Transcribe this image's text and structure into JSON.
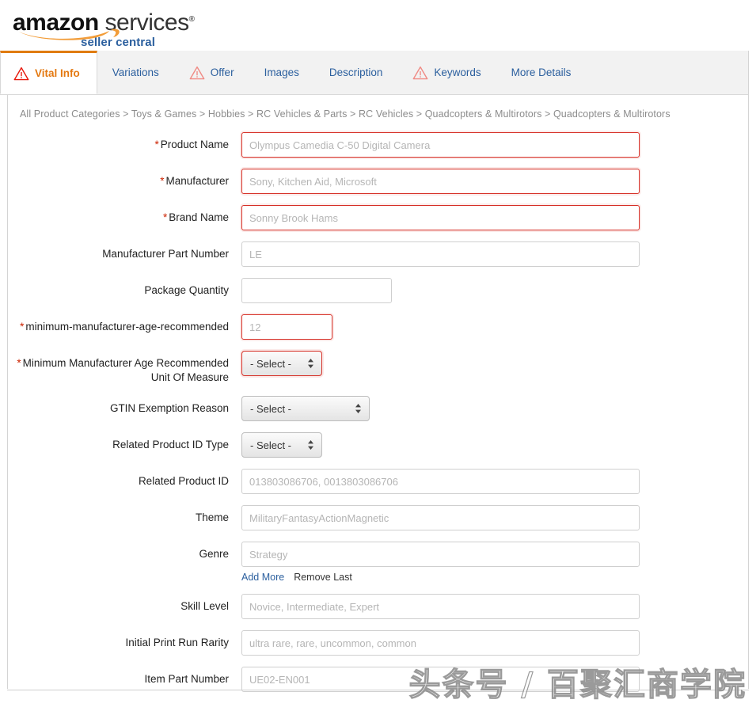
{
  "header": {
    "logo_amazon": "amazon",
    "logo_services": "services",
    "logo_tm": "®",
    "logo_subtitle": "seller central",
    "swoosh_color": "#f29c38"
  },
  "tabs": [
    {
      "label": "Vital Info",
      "icon": "warning-triangle-icon",
      "active": true,
      "has_warning": true
    },
    {
      "label": "Variations",
      "icon": "",
      "active": false,
      "has_warning": false
    },
    {
      "label": "Offer",
      "icon": "warning-triangle-icon",
      "active": false,
      "has_warning": true
    },
    {
      "label": "Images",
      "icon": "",
      "active": false,
      "has_warning": false
    },
    {
      "label": "Description",
      "icon": "",
      "active": false,
      "has_warning": false
    },
    {
      "label": "Keywords",
      "icon": "warning-triangle-icon",
      "active": false,
      "has_warning": true
    },
    {
      "label": "More Details",
      "icon": "",
      "active": false,
      "has_warning": false
    }
  ],
  "breadcrumb": {
    "text": "All Product Categories > Toys & Games > Hobbies > RC Vehicles & Parts > RC Vehicles > Quadcopters & Multirotors > Quadcopters & Multirotors",
    "items": [
      "All Product Categories",
      "Toys & Games",
      "Hobbies",
      "RC Vehicles & Parts",
      "RC Vehicles",
      "Quadcopters & Multirotors",
      "Quadcopters & Multirotors"
    ],
    "separator": ">"
  },
  "form": {
    "required_marker": "*",
    "fields": [
      {
        "label": "Product Name",
        "required": true,
        "type": "text",
        "value": "",
        "placeholder": "Olympus Camedia C-50 Digital Camera",
        "width": "full"
      },
      {
        "label": "Manufacturer",
        "required": true,
        "type": "text",
        "value": "",
        "placeholder": "Sony, Kitchen Aid, Microsoft",
        "width": "full"
      },
      {
        "label": "Brand Name",
        "required": true,
        "type": "text",
        "value": "",
        "placeholder": "Sonny Brook Hams",
        "width": "full"
      },
      {
        "label": "Manufacturer Part Number",
        "required": false,
        "type": "text",
        "value": "",
        "placeholder": "LE",
        "width": "full"
      },
      {
        "label": "Package Quantity",
        "required": false,
        "type": "text",
        "value": "",
        "placeholder": "",
        "width": "med"
      },
      {
        "label": "minimum-manufacturer-age-recommended",
        "required": true,
        "type": "text",
        "value": "",
        "placeholder": "12",
        "width": "small"
      },
      {
        "label": "Minimum Manufacturer Age Recommended Unit Of Measure",
        "required": true,
        "type": "select",
        "value": "- Select -",
        "placeholder": "",
        "width": "narrow"
      },
      {
        "label": "GTIN Exemption Reason",
        "required": false,
        "type": "select",
        "value": "- Select -",
        "placeholder": "",
        "width": "wide"
      },
      {
        "label": "Related Product ID Type",
        "required": false,
        "type": "select",
        "value": "- Select -",
        "placeholder": "",
        "width": "narrow"
      },
      {
        "label": "Related Product ID",
        "required": false,
        "type": "text",
        "value": "",
        "placeholder": "013803086706, 0013803086706",
        "width": "full"
      },
      {
        "label": "Theme",
        "required": false,
        "type": "text",
        "value": "",
        "placeholder": "MilitaryFantasyActionMagnetic",
        "width": "full"
      },
      {
        "label": "Genre",
        "required": false,
        "type": "text",
        "value": "",
        "placeholder": "Strategy",
        "width": "full",
        "sublinks": {
          "add_more": "Add More",
          "remove_last": "Remove Last"
        }
      },
      {
        "label": "Skill Level",
        "required": false,
        "type": "text",
        "value": "",
        "placeholder": "Novice, Intermediate, Expert",
        "width": "full"
      },
      {
        "label": "Initial Print Run Rarity",
        "required": false,
        "type": "text",
        "value": "",
        "placeholder": "ultra rare, rare, uncommon, common",
        "width": "full"
      },
      {
        "label": "Item Part Number",
        "required": false,
        "type": "text",
        "value": "",
        "placeholder": "UE02-EN001",
        "width": "full"
      }
    ]
  },
  "watermark": {
    "text": "头条号 / 百聚汇商学院"
  },
  "colors": {
    "active_tab_text": "#e47911",
    "active_tab_border": "#e07b10",
    "tab_link": "#2b5f9e",
    "required_red": "#cc2200",
    "required_border": "#d62f26",
    "warning_triangle_active": "#e8190c",
    "warning_triangle_inactive": "#f08b85"
  }
}
